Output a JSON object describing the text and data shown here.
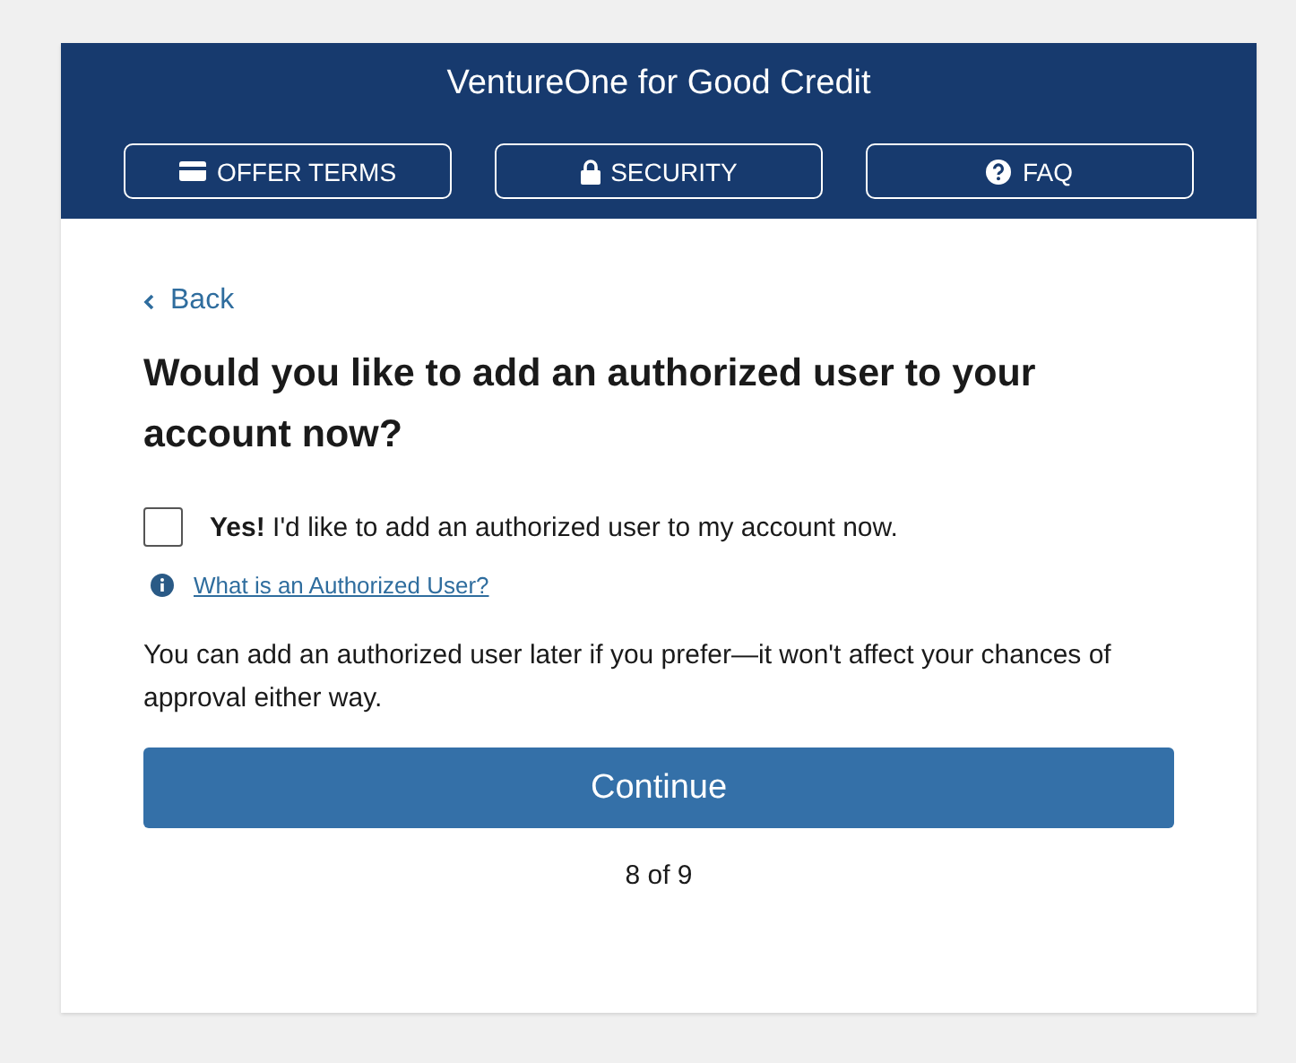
{
  "header": {
    "title": "VentureOne for Good Credit",
    "buttons": [
      {
        "label": "OFFER TERMS"
      },
      {
        "label": "SECURITY"
      },
      {
        "label": "FAQ"
      }
    ]
  },
  "back_link": "Back",
  "heading": "Would you like to add an authorized user to your account now?",
  "checkbox": {
    "label": "**Yes!** I'd like to add an authorized user to my account now.",
    "checked": false
  },
  "help_link": "What is an Authorized User?",
  "note": "You can add an authorized user later if you prefer—it won't affect your chances of approval either way.",
  "continue_button": "Continue",
  "progress": "8 of 9"
}
